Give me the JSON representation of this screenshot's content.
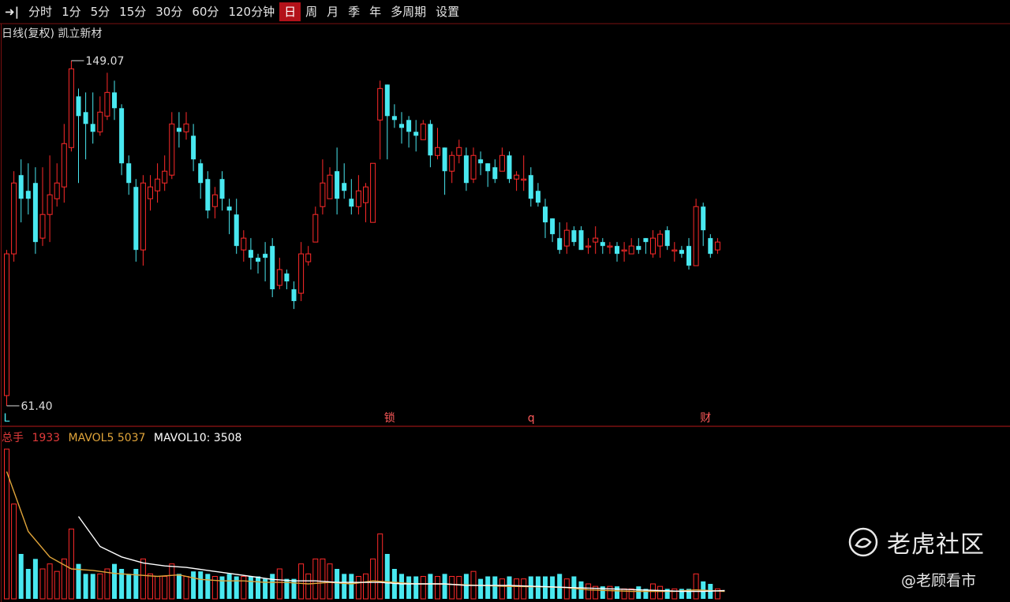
{
  "toolbar": {
    "arrow": "➜|",
    "items": [
      "分时",
      "1分",
      "5分",
      "15分",
      "30分",
      "60分",
      "120分钟",
      "日",
      "周",
      "月",
      "季",
      "年",
      "多周期",
      "设置"
    ],
    "active_index": 7
  },
  "subtitle": "日线(复权) 凯立新材",
  "price_labels": {
    "high": "149.07",
    "low": "61.40"
  },
  "event_markers": [
    "L",
    "锁",
    "q",
    "财"
  ],
  "vol_legend": {
    "label": "总手",
    "value": "1933",
    "ma5": "MAVOL5  5037",
    "ma10": "MAVOL10: 3508"
  },
  "watermark": {
    "brand": "老虎社区",
    "handle": "@老顾看市"
  },
  "colors": {
    "up": "#ff2a2a",
    "down": "#49e8f0",
    "ma5": "#e0a43a",
    "ma10": "#ffffff",
    "ma_green": "#9be86b",
    "active": "#b3121a"
  },
  "chart_data": {
    "type": "candlestick",
    "price_range": [
      61.4,
      149.07
    ],
    "candles": [
      [
        64,
        100,
        61.4,
        101,
        60
      ],
      [
        100,
        118,
        98,
        121,
        38
      ],
      [
        120,
        114,
        108,
        124,
        18
      ],
      [
        116,
        114,
        110,
        123,
        12
      ],
      [
        118,
        103,
        100,
        122,
        16
      ],
      [
        104,
        110,
        102,
        122,
        12
      ],
      [
        110,
        115,
        103,
        125,
        14
      ],
      [
        114,
        118,
        112,
        123,
        11
      ],
      [
        117,
        128,
        113,
        133,
        16
      ],
      [
        127,
        147,
        126,
        149.07,
        28
      ],
      [
        140,
        135,
        118,
        142,
        14
      ],
      [
        136,
        133,
        124,
        141,
        10
      ],
      [
        133,
        131,
        128,
        141,
        10
      ],
      [
        131,
        136,
        130,
        140,
        10
      ],
      [
        135,
        141,
        134,
        146,
        12
      ],
      [
        141,
        137,
        134,
        144,
        14
      ],
      [
        137,
        123,
        120,
        138,
        12
      ],
      [
        123,
        118,
        115,
        125,
        10
      ],
      [
        117,
        101,
        98,
        119,
        12
      ],
      [
        101,
        118,
        97,
        120,
        16
      ],
      [
        114,
        117,
        111,
        120,
        10
      ],
      [
        116,
        119,
        113,
        123,
        9
      ],
      [
        118,
        121,
        116,
        125,
        9
      ],
      [
        120,
        133,
        119,
        136,
        14
      ],
      [
        132,
        131,
        127,
        136,
        10
      ],
      [
        131,
        133,
        129,
        136,
        9
      ],
      [
        130,
        124,
        121,
        133,
        11
      ],
      [
        123,
        118,
        114,
        124,
        11
      ],
      [
        119,
        111,
        109,
        121,
        10
      ],
      [
        112,
        115,
        109,
        117,
        9
      ],
      [
        119,
        114,
        111,
        121,
        9
      ],
      [
        112,
        111,
        105,
        114,
        10
      ],
      [
        110,
        102,
        100,
        114,
        9
      ],
      [
        101,
        104,
        98,
        106,
        9
      ],
      [
        101,
        99,
        96,
        104,
        9
      ],
      [
        99,
        98,
        95,
        100,
        9
      ],
      [
        100,
        99,
        93,
        103,
        8
      ],
      [
        102,
        91,
        89,
        104,
        10
      ],
      [
        92,
        96,
        91,
        99,
        12
      ],
      [
        95,
        93,
        91,
        96,
        8
      ],
      [
        91,
        88,
        86,
        93,
        8
      ],
      [
        90,
        100,
        88,
        103,
        14
      ],
      [
        98,
        100,
        97,
        102,
        10
      ],
      [
        103,
        110,
        103,
        112,
        16
      ],
      [
        112,
        118,
        110,
        124,
        16
      ],
      [
        114,
        120,
        114,
        122,
        14
      ],
      [
        121,
        114,
        110,
        127,
        12
      ],
      [
        118,
        116,
        114,
        123,
        10
      ],
      [
        114,
        112,
        110,
        119,
        10
      ],
      [
        112,
        116,
        110,
        120,
        9
      ],
      [
        113,
        117,
        108,
        118,
        10
      ],
      [
        108,
        123,
        108,
        123,
        16
      ],
      [
        134,
        142,
        124,
        144,
        26
      ],
      [
        143,
        135,
        124,
        143,
        18
      ],
      [
        135,
        134,
        132,
        138,
        12
      ],
      [
        133,
        132,
        128,
        136,
        10
      ],
      [
        134,
        131,
        127,
        135,
        9
      ],
      [
        131,
        130,
        126,
        134,
        9
      ],
      [
        129,
        133,
        129,
        134,
        9
      ],
      [
        133,
        125,
        122,
        134,
        10
      ],
      [
        125,
        127,
        124,
        132,
        9
      ],
      [
        127,
        121,
        115,
        127,
        10
      ],
      [
        121,
        125,
        118,
        126,
        9
      ],
      [
        125,
        127,
        123,
        129,
        9
      ],
      [
        125,
        118,
        116,
        127,
        10
      ],
      [
        119,
        125,
        118,
        127,
        11
      ],
      [
        124,
        123,
        120,
        126,
        8
      ],
      [
        123,
        121,
        117,
        123,
        9
      ],
      [
        122,
        119,
        118,
        124,
        9
      ],
      [
        121,
        125,
        121,
        127,
        8
      ],
      [
        125,
        119,
        118,
        126,
        9
      ],
      [
        119,
        120,
        116,
        121,
        8
      ],
      [
        119,
        119,
        116,
        125,
        8
      ],
      [
        120,
        114,
        112,
        122,
        9
      ],
      [
        116,
        113,
        112,
        118,
        9
      ],
      [
        112,
        108,
        104,
        114,
        9
      ],
      [
        109,
        105,
        103,
        109,
        9
      ],
      [
        104,
        101,
        100,
        108,
        10
      ],
      [
        102,
        106,
        100,
        108,
        8
      ],
      [
        106,
        103,
        102,
        107,
        9
      ],
      [
        106,
        101,
        101,
        107,
        7
      ],
      [
        102,
        102,
        100,
        104,
        6
      ],
      [
        103,
        104,
        100,
        107,
        5
      ],
      [
        103,
        102,
        100,
        104,
        5
      ],
      [
        102,
        102,
        100,
        103,
        5
      ],
      [
        102,
        100,
        98,
        103,
        5
      ],
      [
        101,
        101,
        98,
        103,
        4
      ],
      [
        100,
        102,
        100,
        104,
        4
      ],
      [
        102,
        101,
        100,
        104,
        5
      ],
      [
        104,
        103,
        100,
        104,
        4
      ],
      [
        100,
        104,
        99,
        106,
        6
      ],
      [
        102,
        105,
        99,
        106,
        5
      ],
      [
        106,
        102,
        101,
        107,
        4
      ],
      [
        101,
        101,
        98,
        103,
        4
      ],
      [
        101,
        100,
        99,
        102,
        4
      ],
      [
        102,
        97,
        96,
        104,
        4
      ],
      [
        97,
        112,
        97,
        114,
        10
      ],
      [
        112,
        106,
        102,
        113,
        7
      ],
      [
        104,
        100,
        99,
        105,
        6
      ],
      [
        101,
        103,
        100,
        104,
        4
      ]
    ],
    "ma5": [
      [
        0,
        0.85
      ],
      [
        3,
        0.45
      ],
      [
        6,
        0.28
      ],
      [
        9,
        0.2
      ],
      [
        12,
        0.19
      ],
      [
        15,
        0.17
      ],
      [
        18,
        0.16
      ],
      [
        21,
        0.15
      ],
      [
        24,
        0.16
      ],
      [
        27,
        0.13
      ],
      [
        30,
        0.12
      ],
      [
        33,
        0.12
      ],
      [
        36,
        0.11
      ],
      [
        39,
        0.11
      ],
      [
        42,
        0.1
      ],
      [
        45,
        0.11
      ],
      [
        48,
        0.1
      ],
      [
        51,
        0.12
      ],
      [
        54,
        0.11
      ],
      [
        57,
        0.1
      ],
      [
        60,
        0.1
      ],
      [
        63,
        0.095
      ],
      [
        66,
        0.09
      ],
      [
        69,
        0.085
      ],
      [
        72,
        0.082
      ],
      [
        75,
        0.08
      ],
      [
        78,
        0.075
      ],
      [
        81,
        0.06
      ],
      [
        84,
        0.055
      ],
      [
        87,
        0.05
      ],
      [
        90,
        0.05
      ],
      [
        93,
        0.05
      ],
      [
        96,
        0.06
      ],
      [
        100,
        0.05
      ]
    ],
    "ma10": [
      [
        10,
        0.55
      ],
      [
        13,
        0.35
      ],
      [
        16,
        0.28
      ],
      [
        19,
        0.24
      ],
      [
        22,
        0.22
      ],
      [
        25,
        0.21
      ],
      [
        28,
        0.19
      ],
      [
        31,
        0.17
      ],
      [
        34,
        0.15
      ],
      [
        37,
        0.13
      ],
      [
        40,
        0.12
      ],
      [
        43,
        0.12
      ],
      [
        46,
        0.11
      ],
      [
        49,
        0.11
      ],
      [
        52,
        0.11
      ],
      [
        55,
        0.1
      ],
      [
        58,
        0.1
      ],
      [
        61,
        0.1
      ],
      [
        64,
        0.09
      ],
      [
        67,
        0.09
      ],
      [
        70,
        0.09
      ],
      [
        73,
        0.085
      ],
      [
        76,
        0.08
      ],
      [
        79,
        0.075
      ],
      [
        82,
        0.07
      ],
      [
        85,
        0.065
      ],
      [
        88,
        0.06
      ],
      [
        91,
        0.055
      ],
      [
        94,
        0.05
      ],
      [
        97,
        0.05
      ],
      [
        100,
        0.055
      ]
    ]
  }
}
